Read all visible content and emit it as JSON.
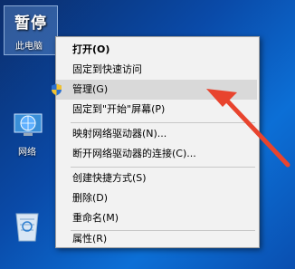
{
  "desktop": {
    "this_pc_label": "此电脑",
    "this_pc_overlay": "暂停",
    "network_label": "网络",
    "recycle_bin_icon": "recycle-bin-icon"
  },
  "context_menu": {
    "items": [
      {
        "label": "打开(O)"
      },
      {
        "label": "固定到快速访问"
      },
      {
        "label": "管理(G)"
      },
      {
        "label": "固定到\"开始\"屏幕(P)"
      },
      {
        "label": "映射网络驱动器(N)..."
      },
      {
        "label": "断开网络驱动器的连接(C)..."
      },
      {
        "label": "创建快捷方式(S)"
      },
      {
        "label": "删除(D)"
      },
      {
        "label": "重命名(M)"
      },
      {
        "label": "属性(R)"
      }
    ]
  },
  "colors": {
    "arrow": "#e8442e",
    "desktop_bg": "#0a4aa8"
  }
}
